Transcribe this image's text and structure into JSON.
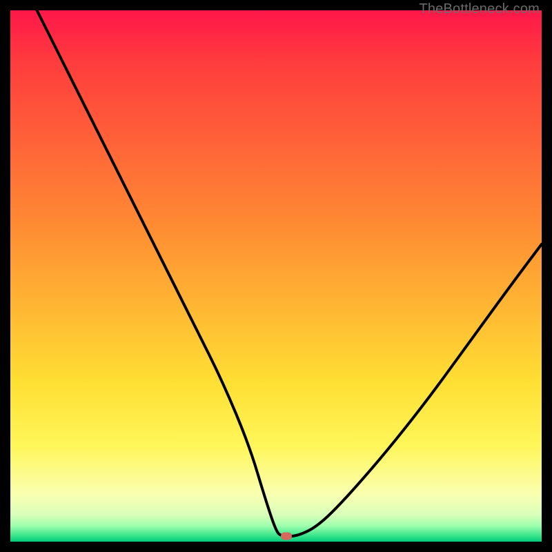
{
  "watermark": "TheBottleneck.com",
  "chart_data": {
    "type": "line",
    "title": "",
    "xlabel": "",
    "ylabel": "",
    "xlim": [
      0,
      100
    ],
    "ylim": [
      0,
      100
    ],
    "grid": false,
    "legend": false,
    "series": [
      {
        "name": "bottleneck-curve",
        "x": [
          5,
          10,
          15,
          20,
          25,
          30,
          35,
          40,
          45,
          48,
          50,
          51,
          54,
          58,
          63,
          70,
          78,
          86,
          94,
          100
        ],
        "y": [
          100,
          90,
          80,
          70,
          60,
          50,
          40,
          30,
          18,
          8,
          2,
          1,
          1,
          3,
          8,
          16,
          26,
          37,
          48,
          56
        ]
      }
    ],
    "vertex": {
      "x": 52,
      "y": 1
    },
    "gradient_stops": [
      {
        "pos": 0,
        "color": "#ff1749"
      },
      {
        "pos": 25,
        "color": "#ff6338"
      },
      {
        "pos": 55,
        "color": "#ffb433"
      },
      {
        "pos": 82,
        "color": "#fff65a"
      },
      {
        "pos": 95,
        "color": "#d8ffba"
      },
      {
        "pos": 100,
        "color": "#00c97a"
      }
    ]
  }
}
